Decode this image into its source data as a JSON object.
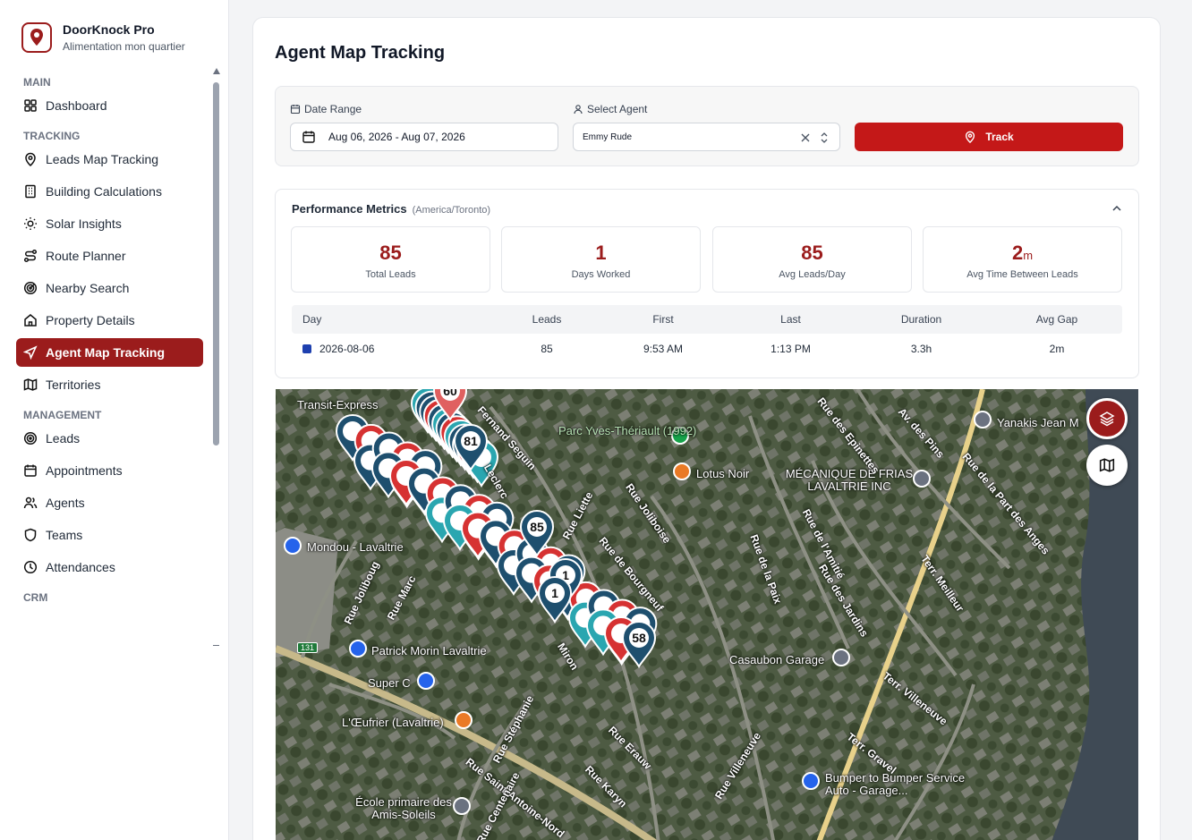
{
  "brand": {
    "title": "DoorKnock Pro",
    "subtitle": "Alimentation mon quartier"
  },
  "sidebar": {
    "sections": [
      {
        "title": "MAIN",
        "items": [
          {
            "label": "Dashboard",
            "icon": "grid-icon"
          }
        ]
      },
      {
        "title": "TRACKING",
        "items": [
          {
            "label": "Leads Map Tracking",
            "icon": "map-pin-icon"
          },
          {
            "label": "Building Calculations",
            "icon": "building-icon"
          },
          {
            "label": "Solar Insights",
            "icon": "sun-icon"
          },
          {
            "label": "Route Planner",
            "icon": "route-icon"
          },
          {
            "label": "Nearby Search",
            "icon": "radar-icon"
          },
          {
            "label": "Property Details",
            "icon": "home-icon"
          },
          {
            "label": "Agent Map Tracking",
            "icon": "navigation-icon",
            "active": true
          },
          {
            "label": "Territories",
            "icon": "map-icon"
          }
        ]
      },
      {
        "title": "MANAGEMENT",
        "items": [
          {
            "label": "Leads",
            "icon": "target-icon"
          },
          {
            "label": "Appointments",
            "icon": "calendar-icon"
          },
          {
            "label": "Agents",
            "icon": "users-icon"
          },
          {
            "label": "Teams",
            "icon": "shield-icon"
          },
          {
            "label": "Attendances",
            "icon": "clock-icon"
          }
        ]
      },
      {
        "title": "CRM",
        "items": []
      }
    ]
  },
  "page": {
    "title": "Agent Map Tracking"
  },
  "filters": {
    "date_label": "Date Range",
    "date_value": "Aug 06, 2026 - Aug 07, 2026",
    "agent_label": "Select Agent",
    "agent_value": "Emmy Rude",
    "track_label": "Track"
  },
  "metrics": {
    "title": "Performance Metrics",
    "timezone": "(America/Toronto)",
    "cards": [
      {
        "value": "85",
        "unit": "",
        "caption": "Total Leads"
      },
      {
        "value": "1",
        "unit": "",
        "caption": "Days Worked"
      },
      {
        "value": "85",
        "unit": "",
        "caption": "Avg Leads/Day"
      },
      {
        "value": "2",
        "unit": "m",
        "caption": "Avg Time Between Leads"
      }
    ],
    "table": {
      "headers": [
        "Day",
        "Leads",
        "First",
        "Last",
        "Duration",
        "Avg Gap"
      ],
      "rows": [
        {
          "day": "2026-08-06",
          "leads": "85",
          "first": "9:53 AM",
          "last": "1:13 PM",
          "duration": "3.3h",
          "gap": "2m",
          "color": "#1e40af"
        }
      ]
    }
  },
  "map": {
    "markers": [
      "60",
      "81",
      "85",
      "1",
      "1",
      "58"
    ],
    "pois": [
      "Transit-Express",
      "Parc Yves-Thériault (1992)",
      "Lotus Noir",
      "MÉCANIQUE DE FRIAS LAVALTRIE INC",
      "Yanakis Jean M",
      "Mondou - Lavaltrie",
      "Patrick Morin Lavaltrie",
      "Super C",
      "L'Œufrier (Lavaltrie)",
      "Casaubon Garage",
      "Bumper to Bumper Service Auto - Garage...",
      "École primaire des Amis-Soleils"
    ],
    "streets": [
      "Fernand Seguin",
      "Leclerc",
      "Rue Liette",
      "Rue Joliboise",
      "Rue de Bourgneuf",
      "Rue de la Paix",
      "Rue de l'Amitié",
      "Rue des Jardins",
      "Rue des Epinettes",
      "Av. des Pins",
      "Rue de la Part des Anges",
      "Terr. Meilleur",
      "Terr. Villeneuve",
      "Terr. Gravel",
      "Rue Villeneuve",
      "Rue Erauw",
      "Rue Karyn",
      "Rue Stéphanie",
      "Rue Saint-Antoine-Nord",
      "Rue Joliboug",
      "Rue Marc",
      "Miron",
      "Rue Centenaire",
      "131"
    ]
  }
}
